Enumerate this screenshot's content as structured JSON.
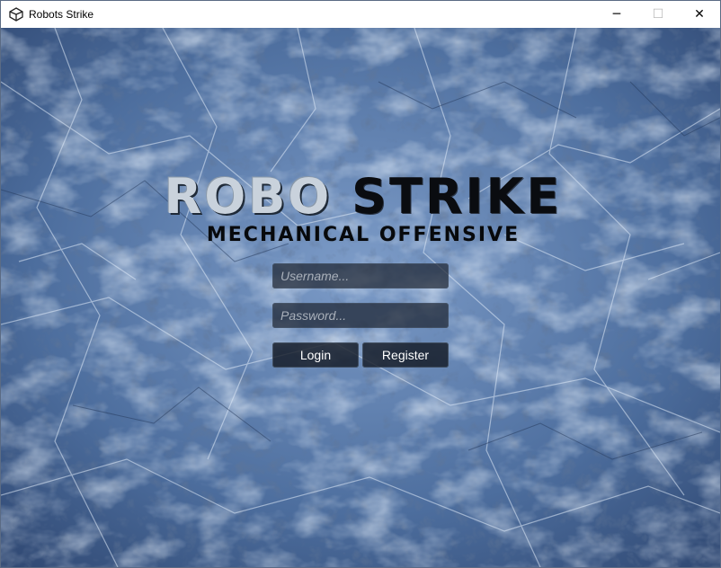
{
  "window": {
    "title": "Robots Strike",
    "icon": "unity-icon",
    "controls": {
      "minimize": "─",
      "maximize": "☐",
      "close": "✕"
    }
  },
  "logo": {
    "word1": "ROBO",
    "word2": "STRIKE",
    "subtitle": "MECHANICAL OFFENSIVE"
  },
  "login_form": {
    "username_placeholder": "Username...",
    "username_value": "",
    "password_placeholder": "Password...",
    "password_value": "",
    "login_label": "Login",
    "register_label": "Register"
  },
  "colors": {
    "field_bg": "#1e2632",
    "button_bg": "#141a24",
    "ice_base": "#5a7aa8"
  }
}
